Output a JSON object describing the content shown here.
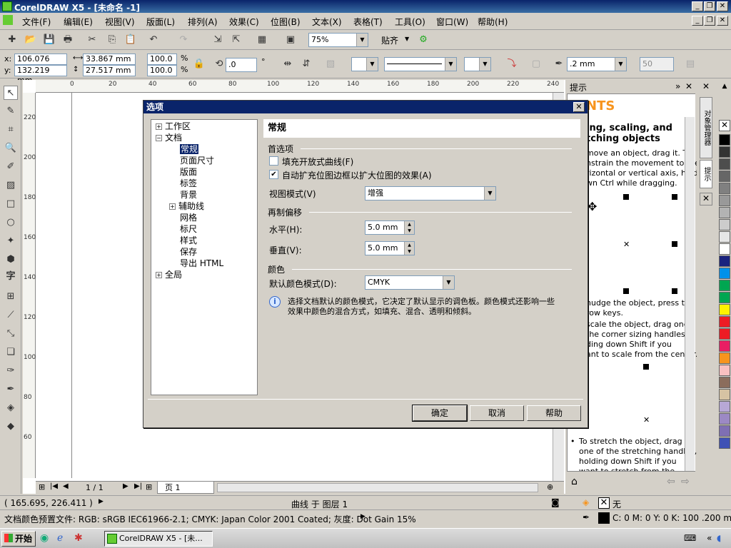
{
  "window": {
    "title": "CorelDRAW X5 - [未命名 -1]"
  },
  "menu": [
    "文件(F)",
    "编辑(E)",
    "视图(V)",
    "版面(L)",
    "排列(A)",
    "效果(C)",
    "位图(B)",
    "文本(X)",
    "表格(T)",
    "工具(O)",
    "窗口(W)",
    "帮助(H)"
  ],
  "toolbar": {
    "zoom": "75%",
    "snap_label": "贴齐"
  },
  "propbar": {
    "x": "106.076 mm",
    "y": "132.219 mm",
    "w": "33.867 mm",
    "h": "27.517 mm",
    "sx": "100.0",
    "sy": "100.0",
    "percent": "%",
    "rotation": ".0",
    "degree": "°",
    "outline_width": ".2 mm",
    "value_50": "50"
  },
  "rulers": {
    "h_ticks": [
      "0",
      "20",
      "40",
      "60",
      "80",
      "100",
      "120",
      "140",
      "160",
      "180",
      "200",
      "220",
      "240"
    ],
    "v_ticks": [
      "220",
      "200",
      "180",
      "160",
      "140",
      "120",
      "100",
      "80",
      "60"
    ]
  },
  "pagenav": {
    "page_count": "1 / 1",
    "page_tab": "页 1"
  },
  "docker": {
    "title": "提示",
    "heading_fragment": "NTS",
    "subheading": "ing, scaling, and\ntching objects",
    "para1": "move an object, drag it. To\nnstrain the movement to the\nrizontal or vertical axis, hold\nwn Ctrl while dragging.",
    "para2": "nudge the object, press the\nrow keys.",
    "para3": "scale the object, drag one\nthe corner sizing handles,\nding down Shift if you\nant to scale from the center.",
    "para4": "To stretch the object, drag\none of the stretching handles,\nholding down Shift if you\nwant to stretch from the",
    "tab_labels": [
      "对象管理器",
      "提示"
    ]
  },
  "status": {
    "coords": "( 165.695, 226.411 )",
    "curve_on_layer": "曲线 于 图层 1",
    "doc_profile": "文档颜色预置文件: RGB: sRGB IEC61966-2.1; CMYK: Japan Color 2001 Coated; 灰度: Dot Gain 15%",
    "fill_none": "无",
    "outline_info": "C: 0 M: 0 Y: 0 K: 100  .200 mm"
  },
  "taskbar": {
    "start": "开始",
    "task": "CorelDRAW X5 - [未..."
  },
  "dialog": {
    "title": "选项",
    "tree": [
      {
        "label": "工作区",
        "level": 0,
        "expander": "+"
      },
      {
        "label": "文档",
        "level": 0,
        "expander": "−"
      },
      {
        "label": "常规",
        "level": 1,
        "selected": true
      },
      {
        "label": "页面尺寸",
        "level": 1
      },
      {
        "label": "版面",
        "level": 1
      },
      {
        "label": "标签",
        "level": 1
      },
      {
        "label": "背景",
        "level": 1
      },
      {
        "label": "辅助线",
        "level": 1,
        "expander": "+"
      },
      {
        "label": "网格",
        "level": 1
      },
      {
        "label": "标尺",
        "level": 1
      },
      {
        "label": "样式",
        "level": 1
      },
      {
        "label": "保存",
        "level": 1
      },
      {
        "label": "导出 HTML",
        "level": 1
      },
      {
        "label": "全局",
        "level": 0,
        "expander": "+"
      }
    ],
    "panel_title": "常规",
    "section_prefs": "首选项",
    "chk_fill_open": "填充开放式曲线(F)",
    "chk_fill_open_checked": false,
    "chk_auto_expand": "自动扩充位图边框以扩大位图的效果(A)",
    "chk_auto_expand_checked": true,
    "view_mode_label": "视图模式(V)",
    "view_mode_value": "增强",
    "section_offset": "再制偏移",
    "horizontal_label": "水平(H):",
    "horizontal_value": "5.0 mm",
    "vertical_label": "垂直(V):",
    "vertical_value": "5.0 mm",
    "section_color": "颜色",
    "color_mode_label": "默认颜色模式(D):",
    "color_mode_value": "CMYK",
    "info_text": "选择文档默认的颜色模式，它决定了默认显示的调色板。颜色模式还影响一些效果中颜色的混合方式，如填充、混合、透明和倾斜。",
    "ok": "确定",
    "cancel": "取消",
    "help": "帮助"
  },
  "palette_colors": [
    "#ffffff",
    "#000000",
    "#333333",
    "#4d4d4d",
    "#666666",
    "#808080",
    "#999999",
    "#b3b3b3",
    "#cccccc",
    "#e6e6e6",
    "#ffffff",
    "#1a237e",
    "#0091ea",
    "#00a651",
    "#00a651",
    "#fff200",
    "#ed1c24",
    "#ed1c24",
    "#e91e63",
    "#f7941d",
    "#f9c0c0",
    "#8b6d5c",
    "#d6c3a3",
    "#b7a8d6",
    "#9c89c4",
    "#7f6fb3",
    "#3f51b5"
  ]
}
